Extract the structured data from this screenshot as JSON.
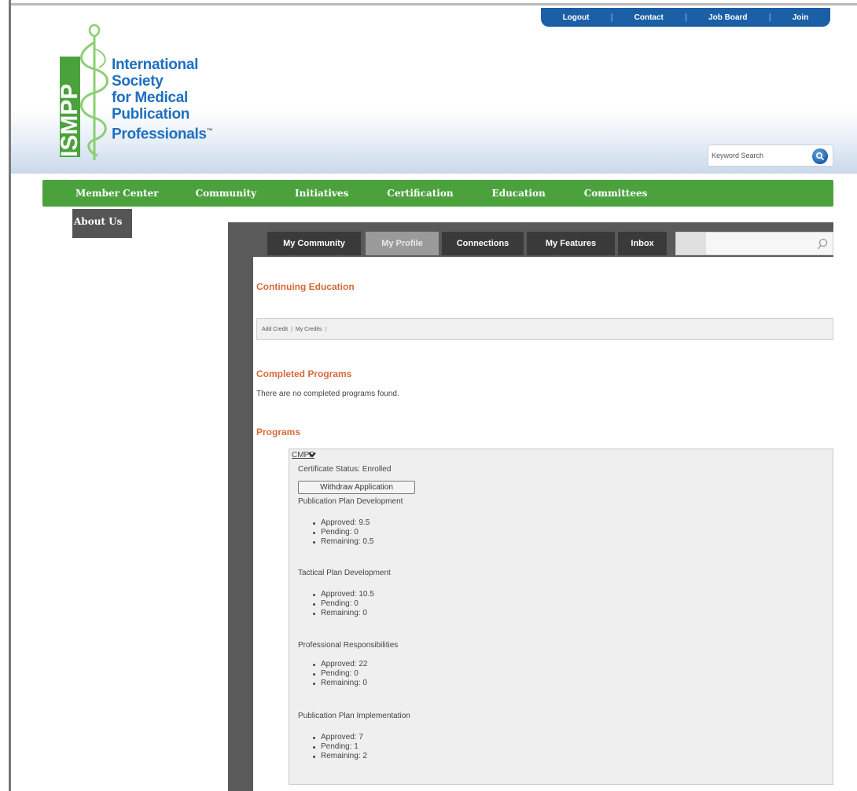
{
  "utility_nav": {
    "logout": "Logout",
    "contact": "Contact",
    "job_board": "Job Board",
    "join": "Join"
  },
  "logo": {
    "acronym": "ISMPP",
    "line1": "International",
    "line2": "Society",
    "line3": "for Medical",
    "line4": "Publication",
    "line5": "Professionals",
    "trademark": "™"
  },
  "search": {
    "value": "Keyword Search"
  },
  "main_nav": {
    "items": [
      "Member Center",
      "Community",
      "Initiatives",
      "Certification",
      "Education",
      "Committees"
    ],
    "about": "About Us"
  },
  "profile_tabs": {
    "items": [
      "My Community",
      "My Profile",
      "Connections",
      "My Features",
      "Inbox"
    ],
    "active": "My Profile"
  },
  "continuing_education": {
    "title": "Continuing Education",
    "add_credit": "Add Credit",
    "my_credits": "My Credits"
  },
  "completed_programs": {
    "title": "Completed Programs",
    "message": "There are no completed programs found."
  },
  "programs": {
    "title": "Programs",
    "program_name": "CMPP",
    "certificate_status": "Certificate Status: Enrolled",
    "withdraw_label": "Withdraw Application",
    "competencies": [
      {
        "name": "Publication Plan Development",
        "approved": "Approved: 9.5",
        "pending": "Pending: 0",
        "remaining": "Remaining: 0.5"
      },
      {
        "name": "Tactical Plan Development",
        "approved": "Approved: 10.5",
        "pending": "Pending: 0",
        "remaining": "Remaining: 0"
      },
      {
        "name": "Professional Responsibilities",
        "approved": "Approved: 22",
        "pending": "Pending: 0",
        "remaining": "Remaining: 0"
      },
      {
        "name": "Publication Plan Implementation",
        "approved": "Approved: 7",
        "pending": "Pending: 1",
        "remaining": "Remaining: 2"
      }
    ]
  },
  "colors": {
    "nav_green": "#4ba23d",
    "util_blue": "#1b5fa6",
    "section_orange": "#d66a3a",
    "tab_dark": "#3a3a3a"
  }
}
